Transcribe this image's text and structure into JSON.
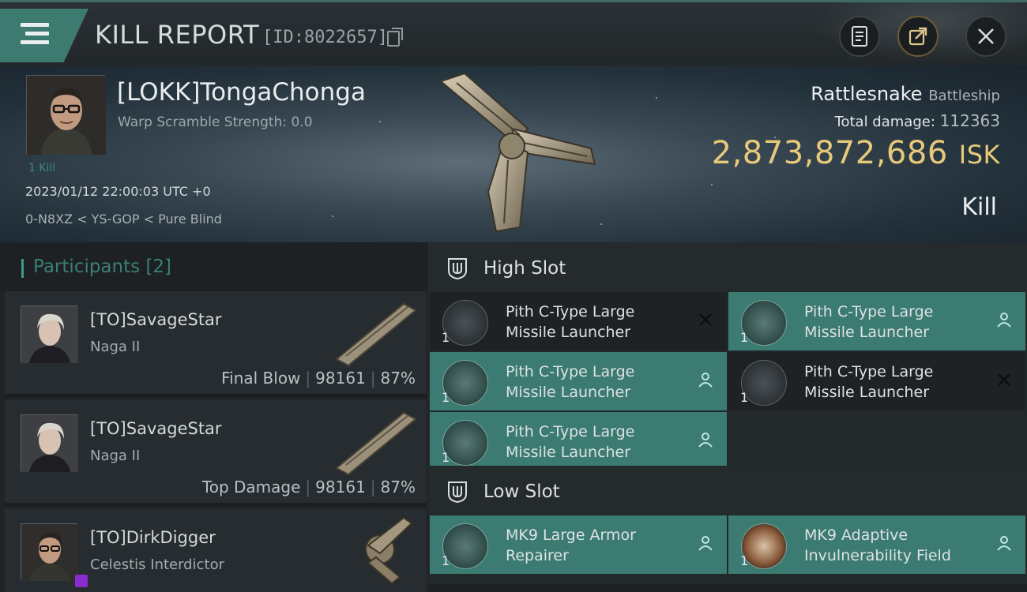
{
  "header": {
    "title": "KILL REPORT",
    "report_id": "[ID:8022657]",
    "buttons": {
      "menu": "menu-icon",
      "notes": "notes-icon",
      "share": "share-icon",
      "close": "close-icon"
    }
  },
  "victim": {
    "name": "[LOKK]TongaChonga",
    "warp_scramble": "Warp Scramble Strength: 0.0",
    "kill_tag": "1 Kill",
    "date": "2023/01/12 22:00:03 UTC +0",
    "location": "0-N8XZ < YS-GOP < Pure Blind",
    "ship_name": "Rattlesnake",
    "ship_class": "Battleship",
    "total_damage_label": "Total damage:",
    "total_damage": "112363",
    "isk_value": "2,873,872,686",
    "isk_unit": "ISK",
    "status": "Kill"
  },
  "participants": {
    "label": "Participants [2]",
    "rows": [
      {
        "name": "[TO]SavageStar",
        "ship": "Naga II",
        "role": "Final Blow",
        "damage": "98161",
        "percent": "87%"
      },
      {
        "name": "[TO]SavageStar",
        "ship": "Naga II",
        "role": "Top Damage",
        "damage": "98161",
        "percent": "87%"
      },
      {
        "name": "[TO]DirkDigger",
        "ship": "Celestis Interdictor",
        "role": "",
        "damage": "",
        "percent": ""
      }
    ]
  },
  "slots": {
    "high": {
      "label": "High Slot",
      "items": [
        {
          "name": "Pith C-Type Large Missile Launcher",
          "qty": "1",
          "state": "destroyed"
        },
        {
          "name": "Pith C-Type Large Missile Launcher",
          "qty": "1",
          "state": "dropped"
        },
        {
          "name": "Pith C-Type Large Missile Launcher",
          "qty": "1",
          "state": "dropped"
        },
        {
          "name": "Pith C-Type Large Missile Launcher",
          "qty": "1",
          "state": "destroyed"
        },
        {
          "name": "Pith C-Type Large Missile Launcher",
          "qty": "1",
          "state": "dropped"
        }
      ]
    },
    "low": {
      "label": "Low Slot",
      "items": [
        {
          "name": "MK9 Large Armor Repairer",
          "qty": "1",
          "state": "dropped"
        },
        {
          "name": "MK9 Adaptive Invulnerability Field",
          "qty": "1",
          "state": "dropped"
        }
      ]
    }
  },
  "colors": {
    "accent": "#3c7b72",
    "isk": "#e8c97b",
    "badge": "#8a2bd0"
  }
}
